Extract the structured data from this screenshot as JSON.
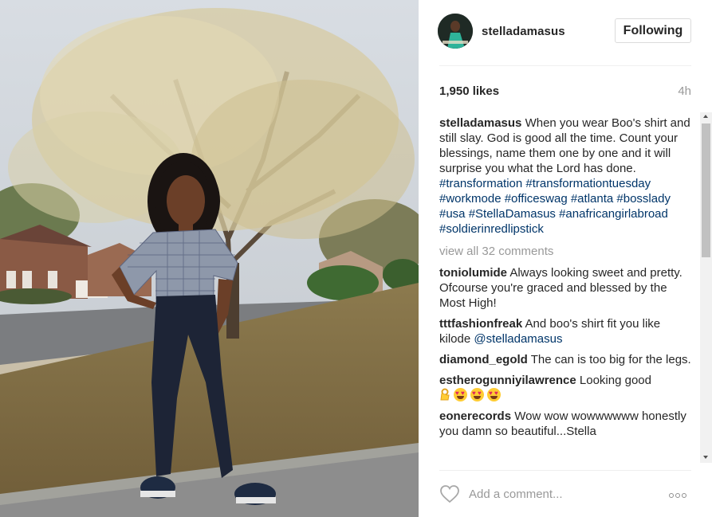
{
  "post": {
    "username": "stelladamasus",
    "follow_label": "Following",
    "likes": "1,950 likes",
    "time_ago": "4h"
  },
  "caption": {
    "user": "stelladamasus",
    "text": "When you wear Boo's shirt and still slay. God is good all the time. Count your blessings, name them one by one and it will surprise you what the Lord has done.",
    "hashtags": [
      "#transformation",
      "#transformationtuesday",
      "#workmode",
      "#officeswag",
      "#atlanta",
      "#bosslady",
      "#usa",
      "#StellaDamasus",
      "#anafricangirlabroad",
      "#soldierinredlipstick"
    ]
  },
  "view_all_comments": "view all 32 comments",
  "comments": [
    {
      "user": "toniolumide",
      "text": "Always looking sweet and pretty. Ofcourse you're graced and blessed by the Most High!"
    },
    {
      "user": "tttfashionfreak",
      "text": "And boo's shirt fit you like kilode",
      "mention": "@stelladamasus"
    },
    {
      "user": "diamond_egold",
      "text": "The can is too big for the legs."
    },
    {
      "user": "estherogunniyilawrence",
      "text": "Looking good"
    },
    {
      "user": "eonerecords",
      "text": "Wow wow wowwwwww honestly you damn so beautiful...Stella"
    }
  ],
  "comment_input": {
    "placeholder": "Add a comment..."
  },
  "icons": {
    "like": "heart-icon",
    "more": "more-options-icon",
    "emoji_ok": "ok-hand-emoji",
    "emoji_heart_eyes": "heart-eyes-emoji"
  },
  "colors": {
    "text": "#262626",
    "muted": "#999999",
    "link": "#003569",
    "border": "#dbdbdb"
  }
}
